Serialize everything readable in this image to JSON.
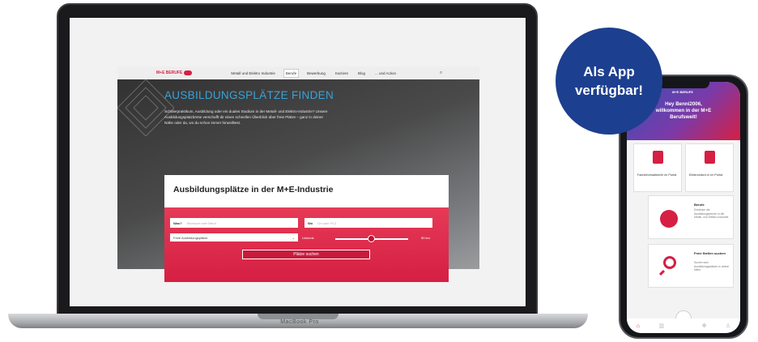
{
  "badge": {
    "line1": "Als App",
    "line2": "verfügbar!"
  },
  "laptop": {
    "brand": "MacBook Pro"
  },
  "site": {
    "logo": "M+E BERUFE",
    "nav": [
      "Metall und Elektro Industrie",
      "Berufe",
      "Bewerbung",
      "Karriere",
      "Blog",
      "... und Action"
    ],
    "active_nav": "Berufe",
    "hero_title": "AUSBILDUNGSPLÄTZE FINDEN",
    "hero_text": "Schülerpraktikum, Ausbildung oder ein duales Studium in der Metall- und Elektro-Industrie? Unsere Ausbildungsplatzbörse verschafft dir einen schnellen Überblick über freie Plätze – ganz in deiner Nähe oder da, wo du schon immer hinwolltest.",
    "card_title": "Ausbildungsplätze in der M+E-Industrie",
    "was_label": "Was?",
    "was_placeholder": "Stichwort oder Beruf",
    "wo_label": "Wo",
    "wo_placeholder": "Ort oder PLZ",
    "select_value": "Freie Ausbildungsplätze",
    "umkreis_label": "Umkreis",
    "umkreis_value": "50 km",
    "submit": "Plätze suchen"
  },
  "phone": {
    "logo": "M+E BERUFE",
    "greeting_1": "Hey Benni2006,",
    "greeting_2": "willkommen in der M+E",
    "greeting_3": "Berufswelt!",
    "tile1_label": "Fachinformatiker/in im Portal",
    "tile2_label": "Elektroniker/-in im Portal",
    "tile3_title": "Berufe",
    "tile3_desc": "Entdecke die Ausbildungsberufe in der Metall- und Elektro-Industrie",
    "tile4_title": "Freie Stellen suchen",
    "tile4_desc": "Suche nach Ausbildungsplätzen in deiner Nähe"
  }
}
